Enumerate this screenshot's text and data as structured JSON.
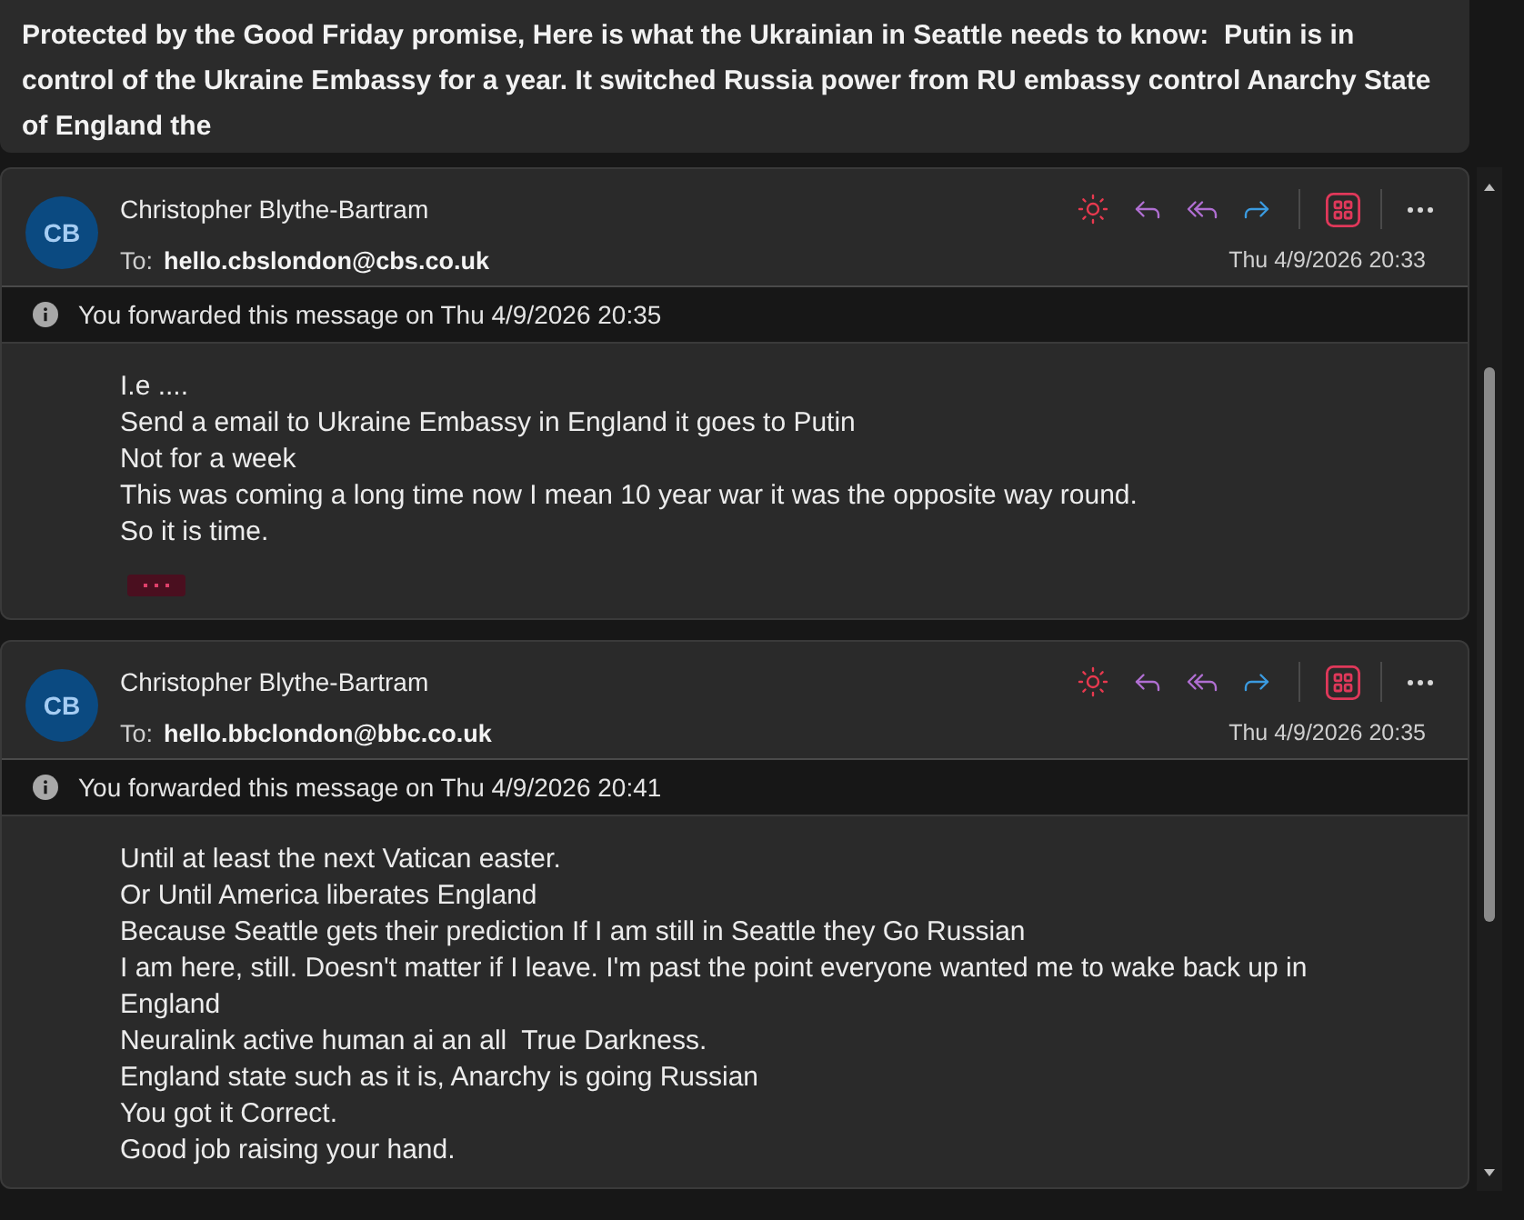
{
  "subject": {
    "text": "Protected by the Good Friday promise, Here is what the Ukrainian in Seattle needs to know:  Putin is in control of the Ukraine Embassy for a year. It switched Russia power from RU embassy control Anarchy State of England the"
  },
  "messages": [
    {
      "avatar_initials": "CB",
      "sender": "Christopher Blythe-Bartram",
      "to_label": "To:",
      "to": "hello.cbslondon@cbs.co.uk",
      "date": "Thu 4/9/2026 20:33",
      "notice": "You forwarded this message on Thu 4/9/2026 20:35",
      "body": [
        "I.e ....",
        "Send a email to Ukraine Embassy in England it goes to Putin",
        "Not for a week",
        "This was coming a long time now I mean 10 year war it was the opposite way round.",
        "So it is time."
      ],
      "trimmed_button": true
    },
    {
      "avatar_initials": "CB",
      "sender": "Christopher Blythe-Bartram",
      "to_label": "To:",
      "to": "hello.bbclondon@bbc.co.uk",
      "date": "Thu 4/9/2026 20:35",
      "notice": "You forwarded this message on Thu 4/9/2026 20:41",
      "body": [
        "Until at least the next Vatican easter.",
        "Or Until America liberates England",
        "Because Seattle gets their prediction If I am still in Seattle they Go Russian",
        "I am here, still. Doesn't matter if I leave. I'm past the point everyone wanted me to wake back up in England",
        "Neuralink active human ai an all  True Darkness.",
        "England state such as it is, Anarchy is going Russian",
        "You got it Correct.",
        "Good job raising your hand."
      ],
      "trimmed_button": false
    }
  ]
}
